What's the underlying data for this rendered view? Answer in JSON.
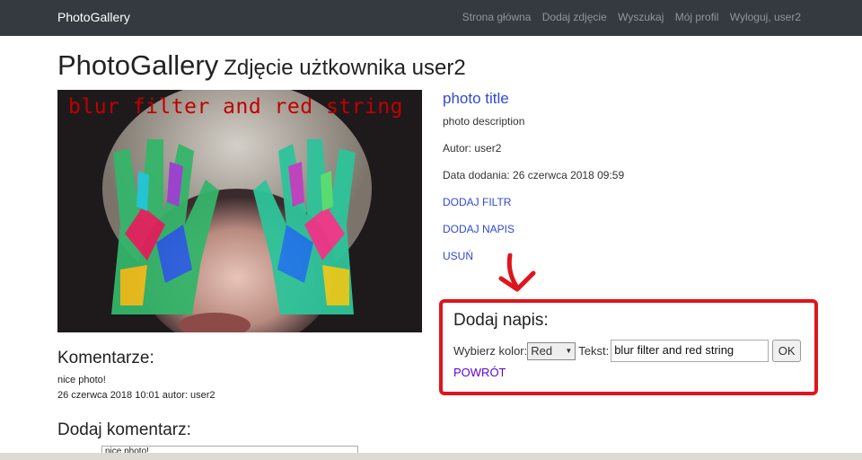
{
  "navbar": {
    "brand": "PhotoGallery",
    "links": [
      "Strona główna",
      "Dodaj zdjęcie",
      "Wyszukaj",
      "Mój profil",
      "Wyloguj, user2"
    ]
  },
  "heading": {
    "title": "PhotoGallery",
    "subtitle": "Zdjęcie użtkownika user2"
  },
  "photo": {
    "overlay_text": "blur filter and red string",
    "overlay_color": "#c00000"
  },
  "details": {
    "title": "photo title",
    "description": "photo description",
    "author": "Autor: user2",
    "date": "Data dodania: 26 czerwca 2018 09:59",
    "actions": [
      "DODAJ FILTR",
      "DODAJ NAPIS",
      "USUŃ"
    ]
  },
  "caption_form": {
    "title": "Dodaj napis:",
    "color_label": "Wybierz kolor:",
    "color_value": "Red",
    "text_label": "Tekst:",
    "text_value": "blur filter and red string",
    "ok_label": "OK",
    "back_label": "POWRÓT",
    "highlight_color": "#e0141c"
  },
  "comments": {
    "title": "Komentarze:",
    "items": [
      {
        "text": "nice photo!",
        "meta": "26 czerwca 2018 10:01 autor: user2"
      }
    ]
  },
  "add_comment": {
    "title": "Dodaj komentarz:",
    "input_value": "nice photo!"
  }
}
